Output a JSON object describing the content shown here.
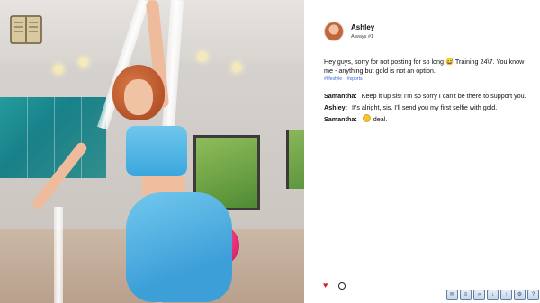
{
  "post": {
    "author": "Ashley",
    "subtitle": "Always #1",
    "text": "Hey guys, sorry for not posting for so long 😅 Training 24\\7. You know me -  anything but gold is not an option.",
    "tags": [
      "#lifestyle",
      "#sports"
    ]
  },
  "comments": [
    {
      "author": "Samantha:",
      "text": "Keep it up sis! I'm so sorry I can't be there to support you."
    },
    {
      "author": "Ashley:",
      "text": "It's alright, sis. I'll send you my first selfie with gold."
    },
    {
      "author": "Samantha:",
      "text": "deal."
    }
  ],
  "toolbar": {
    "icons": [
      "chat-icon",
      "list-icon",
      "skip-icon",
      "save-icon",
      "load-icon",
      "settings-icon",
      "help-icon",
      "fullscreen-icon"
    ]
  },
  "colors": {
    "heart": "#e21b2b",
    "tag": "#3a6ad8",
    "panel_bg": "#ffffff"
  }
}
